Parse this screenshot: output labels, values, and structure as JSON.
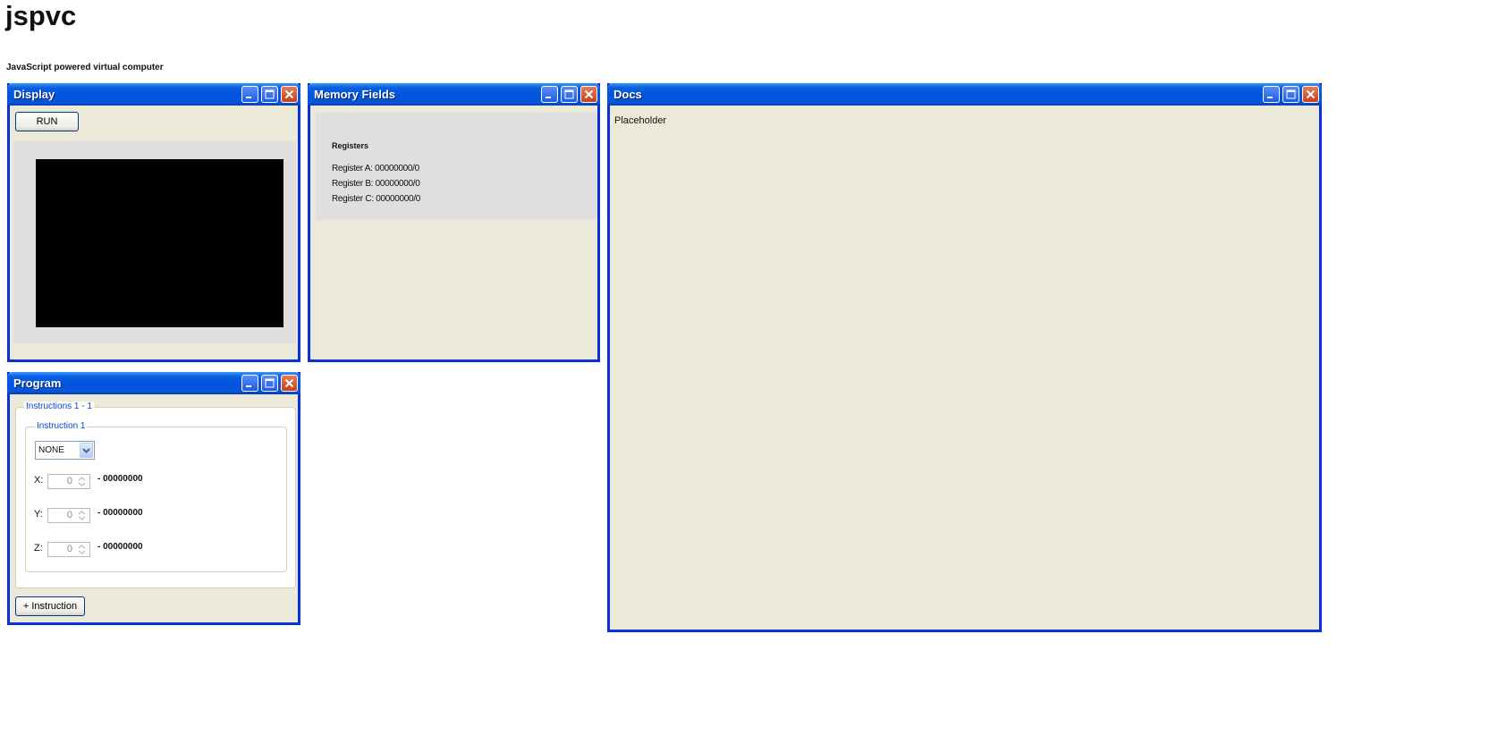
{
  "page": {
    "title": "jspvc",
    "subtitle": "JavaScript powered virtual computer"
  },
  "windows": {
    "display": {
      "title": "Display",
      "run_label": "RUN"
    },
    "memory": {
      "title": "Memory Fields",
      "registers_title": "Registers",
      "registers": [
        "Register A: 00000000/0",
        "Register B: 00000000/0",
        "Register C: 00000000/0"
      ]
    },
    "docs": {
      "title": "Docs",
      "text": "Placeholder"
    },
    "program": {
      "title": "Program",
      "group_legend": "Instructions 1 - 1",
      "instruction_legend": "Instruction 1",
      "opcode_selected": "NONE",
      "coords": [
        {
          "label": "X:",
          "value": "0",
          "binary": "- 00000000"
        },
        {
          "label": "Y:",
          "value": "0",
          "binary": "- 00000000"
        },
        {
          "label": "Z:",
          "value": "0",
          "binary": "- 00000000"
        }
      ],
      "add_instruction_label": "+ Instruction"
    }
  },
  "colors": {
    "titlebar": "#0053e0",
    "window_border": "#0831d9",
    "window_bg": "#ece9d8",
    "close_button": "#c9401b",
    "legend_text": "#0046d5"
  },
  "icons": [
    "minimize-icon",
    "maximize-icon",
    "close-icon",
    "chevron-down-icon",
    "spinner-arrows-icon"
  ]
}
